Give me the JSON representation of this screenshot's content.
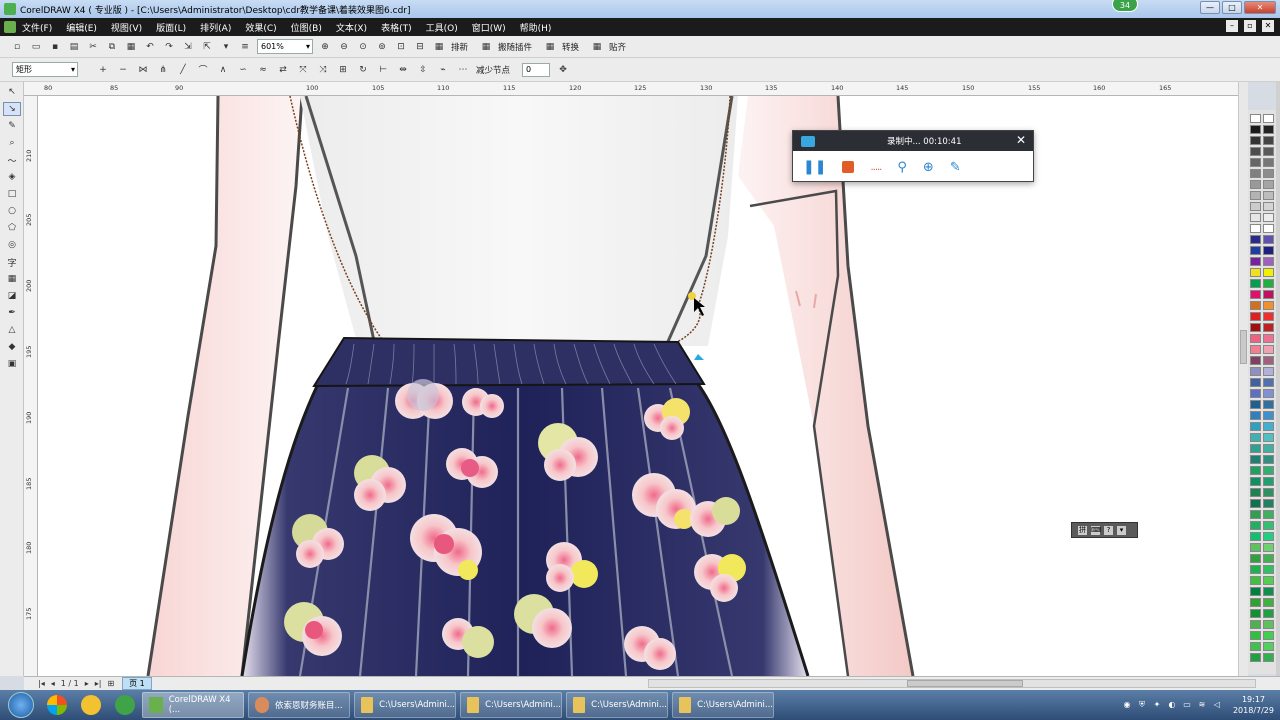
{
  "window": {
    "title": "CorelDRAW X4 ( 专业版 ) - [C:\\Users\\Administrator\\Desktop\\cdr教学备课\\着装效果图6.cdr]",
    "badge": "34",
    "controls": [
      "—",
      "□",
      "✕"
    ]
  },
  "menu": [
    "文件(F)",
    "编辑(E)",
    "视图(V)",
    "版面(L)",
    "排列(A)",
    "效果(C)",
    "位图(B)",
    "文本(X)",
    "表格(T)",
    "工具(O)",
    "窗口(W)",
    "帮助(H)"
  ],
  "toolbar": {
    "zoom": "601%",
    "buttons": [
      "排新",
      "搬随插件",
      "转换",
      "贴齐"
    ]
  },
  "property_bar": {
    "shape": "矩形",
    "reduce_nodes_label": "减少节点",
    "reduce_nodes_value": "0"
  },
  "ruler": {
    "top_ticks": [
      "80",
      "85",
      "90",
      "100",
      "105",
      "110",
      "115",
      "120",
      "125",
      "130",
      "135",
      "140",
      "145",
      "150",
      "155",
      "160",
      "165"
    ],
    "left_ticks": [
      "210",
      "205",
      "200",
      "195",
      "190",
      "185",
      "180",
      "175"
    ]
  },
  "recorder": {
    "status": "录制中... 00:10:41",
    "close": "✕",
    "dots": "....."
  },
  "status": {
    "page_indicator": "1 / 1",
    "page_tab": "页 1"
  },
  "taskbar": {
    "tasks": [
      {
        "label": "CorelDRAW X4 (...",
        "active": true
      },
      {
        "label": "依索恩财务账目...",
        "active": false
      },
      {
        "label": "C:\\Users\\Admini...",
        "active": false
      },
      {
        "label": "C:\\Users\\Admini...",
        "active": false
      },
      {
        "label": "C:\\Users\\Admini...",
        "active": false
      },
      {
        "label": "C:\\Users\\Admini...",
        "active": false
      }
    ],
    "time": "19:17",
    "date": "2018/7/29"
  },
  "colors": {
    "skirt": "#2a2d63",
    "skin": "#f6e4e4",
    "accent_orange": "#e25c2a"
  }
}
